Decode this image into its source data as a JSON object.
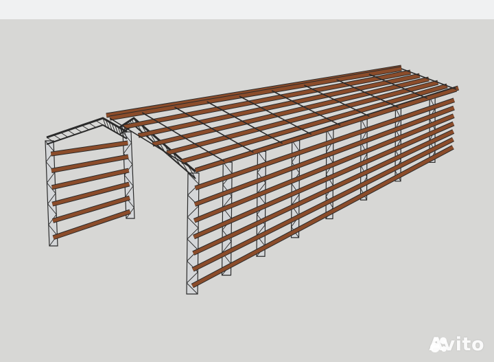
{
  "image": {
    "subject": "steel-frame-warehouse-3d-model",
    "background_color": "#d7d7d5",
    "header_strip_color": "#f0f1f2",
    "beam_color": "#8b4c2a",
    "column_color": "#d4d6d8",
    "outline_color": "#2a2a2a"
  },
  "watermark": {
    "text": "Avito",
    "logo": "avito-dots-logo"
  }
}
